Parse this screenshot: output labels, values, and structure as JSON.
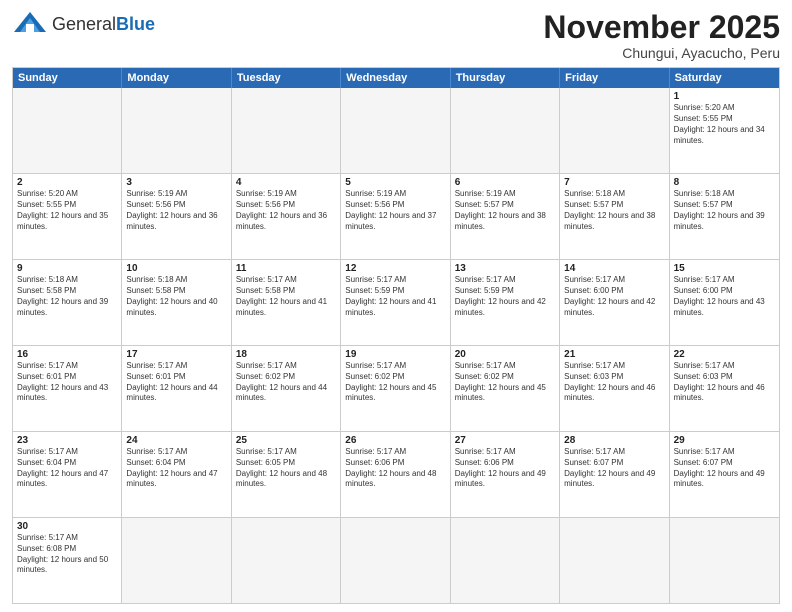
{
  "header": {
    "logo_general": "General",
    "logo_blue": "Blue",
    "month_title": "November 2025",
    "location": "Chungui, Ayacucho, Peru"
  },
  "days_of_week": [
    "Sunday",
    "Monday",
    "Tuesday",
    "Wednesday",
    "Thursday",
    "Friday",
    "Saturday"
  ],
  "weeks": [
    [
      {
        "day": "",
        "empty": true
      },
      {
        "day": "",
        "empty": true
      },
      {
        "day": "",
        "empty": true
      },
      {
        "day": "",
        "empty": true
      },
      {
        "day": "",
        "empty": true
      },
      {
        "day": "",
        "empty": true
      },
      {
        "day": "1",
        "sunrise": "5:20 AM",
        "sunset": "5:55 PM",
        "daylight": "12 hours and 34 minutes."
      }
    ],
    [
      {
        "day": "2",
        "sunrise": "5:20 AM",
        "sunset": "5:55 PM",
        "daylight": "12 hours and 35 minutes."
      },
      {
        "day": "3",
        "sunrise": "5:19 AM",
        "sunset": "5:56 PM",
        "daylight": "12 hours and 36 minutes."
      },
      {
        "day": "4",
        "sunrise": "5:19 AM",
        "sunset": "5:56 PM",
        "daylight": "12 hours and 36 minutes."
      },
      {
        "day": "5",
        "sunrise": "5:19 AM",
        "sunset": "5:56 PM",
        "daylight": "12 hours and 37 minutes."
      },
      {
        "day": "6",
        "sunrise": "5:19 AM",
        "sunset": "5:57 PM",
        "daylight": "12 hours and 38 minutes."
      },
      {
        "day": "7",
        "sunrise": "5:18 AM",
        "sunset": "5:57 PM",
        "daylight": "12 hours and 38 minutes."
      },
      {
        "day": "8",
        "sunrise": "5:18 AM",
        "sunset": "5:57 PM",
        "daylight": "12 hours and 39 minutes."
      }
    ],
    [
      {
        "day": "9",
        "sunrise": "5:18 AM",
        "sunset": "5:58 PM",
        "daylight": "12 hours and 39 minutes."
      },
      {
        "day": "10",
        "sunrise": "5:18 AM",
        "sunset": "5:58 PM",
        "daylight": "12 hours and 40 minutes."
      },
      {
        "day": "11",
        "sunrise": "5:17 AM",
        "sunset": "5:58 PM",
        "daylight": "12 hours and 41 minutes."
      },
      {
        "day": "12",
        "sunrise": "5:17 AM",
        "sunset": "5:59 PM",
        "daylight": "12 hours and 41 minutes."
      },
      {
        "day": "13",
        "sunrise": "5:17 AM",
        "sunset": "5:59 PM",
        "daylight": "12 hours and 42 minutes."
      },
      {
        "day": "14",
        "sunrise": "5:17 AM",
        "sunset": "6:00 PM",
        "daylight": "12 hours and 42 minutes."
      },
      {
        "day": "15",
        "sunrise": "5:17 AM",
        "sunset": "6:00 PM",
        "daylight": "12 hours and 43 minutes."
      }
    ],
    [
      {
        "day": "16",
        "sunrise": "5:17 AM",
        "sunset": "6:01 PM",
        "daylight": "12 hours and 43 minutes."
      },
      {
        "day": "17",
        "sunrise": "5:17 AM",
        "sunset": "6:01 PM",
        "daylight": "12 hours and 44 minutes."
      },
      {
        "day": "18",
        "sunrise": "5:17 AM",
        "sunset": "6:02 PM",
        "daylight": "12 hours and 44 minutes."
      },
      {
        "day": "19",
        "sunrise": "5:17 AM",
        "sunset": "6:02 PM",
        "daylight": "12 hours and 45 minutes."
      },
      {
        "day": "20",
        "sunrise": "5:17 AM",
        "sunset": "6:02 PM",
        "daylight": "12 hours and 45 minutes."
      },
      {
        "day": "21",
        "sunrise": "5:17 AM",
        "sunset": "6:03 PM",
        "daylight": "12 hours and 46 minutes."
      },
      {
        "day": "22",
        "sunrise": "5:17 AM",
        "sunset": "6:03 PM",
        "daylight": "12 hours and 46 minutes."
      }
    ],
    [
      {
        "day": "23",
        "sunrise": "5:17 AM",
        "sunset": "6:04 PM",
        "daylight": "12 hours and 47 minutes."
      },
      {
        "day": "24",
        "sunrise": "5:17 AM",
        "sunset": "6:04 PM",
        "daylight": "12 hours and 47 minutes."
      },
      {
        "day": "25",
        "sunrise": "5:17 AM",
        "sunset": "6:05 PM",
        "daylight": "12 hours and 48 minutes."
      },
      {
        "day": "26",
        "sunrise": "5:17 AM",
        "sunset": "6:06 PM",
        "daylight": "12 hours and 48 minutes."
      },
      {
        "day": "27",
        "sunrise": "5:17 AM",
        "sunset": "6:06 PM",
        "daylight": "12 hours and 49 minutes."
      },
      {
        "day": "28",
        "sunrise": "5:17 AM",
        "sunset": "6:07 PM",
        "daylight": "12 hours and 49 minutes."
      },
      {
        "day": "29",
        "sunrise": "5:17 AM",
        "sunset": "6:07 PM",
        "daylight": "12 hours and 49 minutes."
      }
    ],
    [
      {
        "day": "30",
        "sunrise": "5:17 AM",
        "sunset": "6:08 PM",
        "daylight": "12 hours and 50 minutes."
      },
      {
        "day": "",
        "empty": true
      },
      {
        "day": "",
        "empty": true
      },
      {
        "day": "",
        "empty": true
      },
      {
        "day": "",
        "empty": true
      },
      {
        "day": "",
        "empty": true
      },
      {
        "day": "",
        "empty": true
      }
    ]
  ]
}
